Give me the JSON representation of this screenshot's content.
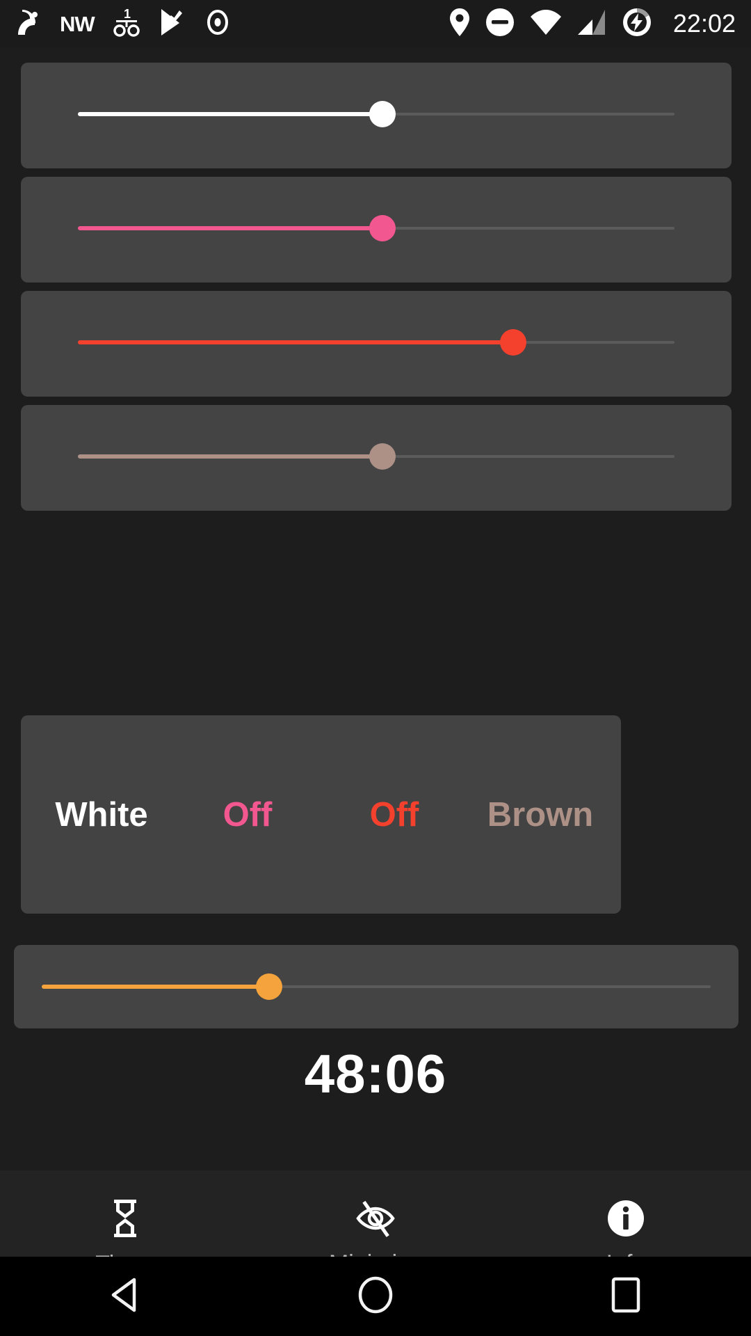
{
  "statusbar": {
    "icons_left": [
      "satellite-dish-icon",
      "nw-compass-text",
      "balance-scale-icon",
      "checkbox-flag-icon",
      "record-circle-icon"
    ],
    "nw_label": "NW",
    "balance_label": "1",
    "icons_right": [
      "location-pin-icon",
      "do-not-disturb-icon",
      "wifi-icon",
      "cellular-signal-icon",
      "battery-charging-icon"
    ],
    "clock": "22:02"
  },
  "colors": {
    "background": "#1d1d1d",
    "card": "#444444",
    "track": "#5b5b5b",
    "white": "#ffffff",
    "pink": "#f2578f",
    "red": "#f4412e",
    "brown": "#ad9187",
    "orange": "#f5a33c"
  },
  "sliders": [
    {
      "name": "white-brightness-slider",
      "color": "#ffffff",
      "percent": 51
    },
    {
      "name": "pink-brightness-slider",
      "color": "#f2578f",
      "percent": 51
    },
    {
      "name": "red-brightness-slider",
      "color": "#f4412e",
      "percent": 73
    },
    {
      "name": "brown-brightness-slider",
      "color": "#ad9187",
      "percent": 51
    }
  ],
  "timer_slider": {
    "name": "timer-duration-slider",
    "color": "#f5a33c",
    "percent": 34
  },
  "presets": [
    {
      "label": "White",
      "color": "#ffffff"
    },
    {
      "label": "Off",
      "color": "#f2578f"
    },
    {
      "label": "Off",
      "color": "#f4412e"
    },
    {
      "label": "Brown",
      "color": "#ad9187"
    }
  ],
  "timer": {
    "value": "48:06"
  },
  "bottom_nav": [
    {
      "label": "Timer",
      "icon": "hourglass-icon"
    },
    {
      "label": "Minimize",
      "icon": "eye-off-icon"
    },
    {
      "label": "Info",
      "icon": "info-circle-icon"
    }
  ],
  "android_nav": [
    {
      "name": "back-button",
      "icon": "triangle-back-icon"
    },
    {
      "name": "home-button",
      "icon": "circle-home-icon"
    },
    {
      "name": "recents-button",
      "icon": "square-recents-icon"
    }
  ]
}
